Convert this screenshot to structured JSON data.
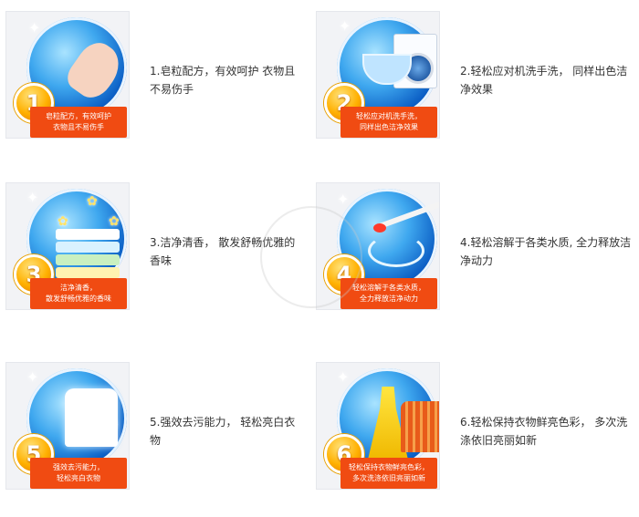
{
  "features": [
    {
      "number": "1",
      "caption_line1": "皂粒配方，有效呵护",
      "caption_line2": "衣物且不易伤手",
      "desc_line1": "1.皂粒配方，有效呵护 衣物且",
      "desc_line2": "不易伤手",
      "icon": "hand-icon"
    },
    {
      "number": "2",
      "caption_line1": "轻松应对机洗手洗，",
      "caption_line2": "同样出色洁净效果",
      "desc_line1": "2.轻松应对机洗手洗， 同样出色洁",
      "desc_line2": "净效果",
      "icon": "washing-machine-icon"
    },
    {
      "number": "3",
      "caption_line1": "洁净清香，",
      "caption_line2": "散发舒畅优雅的香味",
      "desc_line1": "3.洁净清香， 散发舒畅优雅的",
      "desc_line2": "香味",
      "icon": "folded-towels-icon"
    },
    {
      "number": "4",
      "caption_line1": "轻松溶解于各类水质，",
      "caption_line2": "全力释放洁净动力",
      "desc_line1": "4.轻松溶解于各类水质, 全力释放洁",
      "desc_line2": "净动力",
      "icon": "detergent-spoon-icon"
    },
    {
      "number": "5",
      "caption_line1": "强效去污能力，",
      "caption_line2": "轻松亮白衣物",
      "desc_line1": "5.强效去污能力， 轻松亮白衣",
      "desc_line2": "物",
      "icon": "white-shirt-icon"
    },
    {
      "number": "6",
      "caption_line1": "轻松保持衣物鲜亮色彩，",
      "caption_line2": "多次洗涤依旧亮丽如新",
      "desc_line1": "6.轻松保持衣物鲜亮色彩， 多次洗",
      "desc_line2": "涤依旧亮丽如新",
      "icon": "colorful-clothes-icon"
    }
  ],
  "colors": {
    "caption_bg": "#f04b12",
    "badge": "#ffb000",
    "globe": "#0c5fc5",
    "text": "#333333"
  }
}
